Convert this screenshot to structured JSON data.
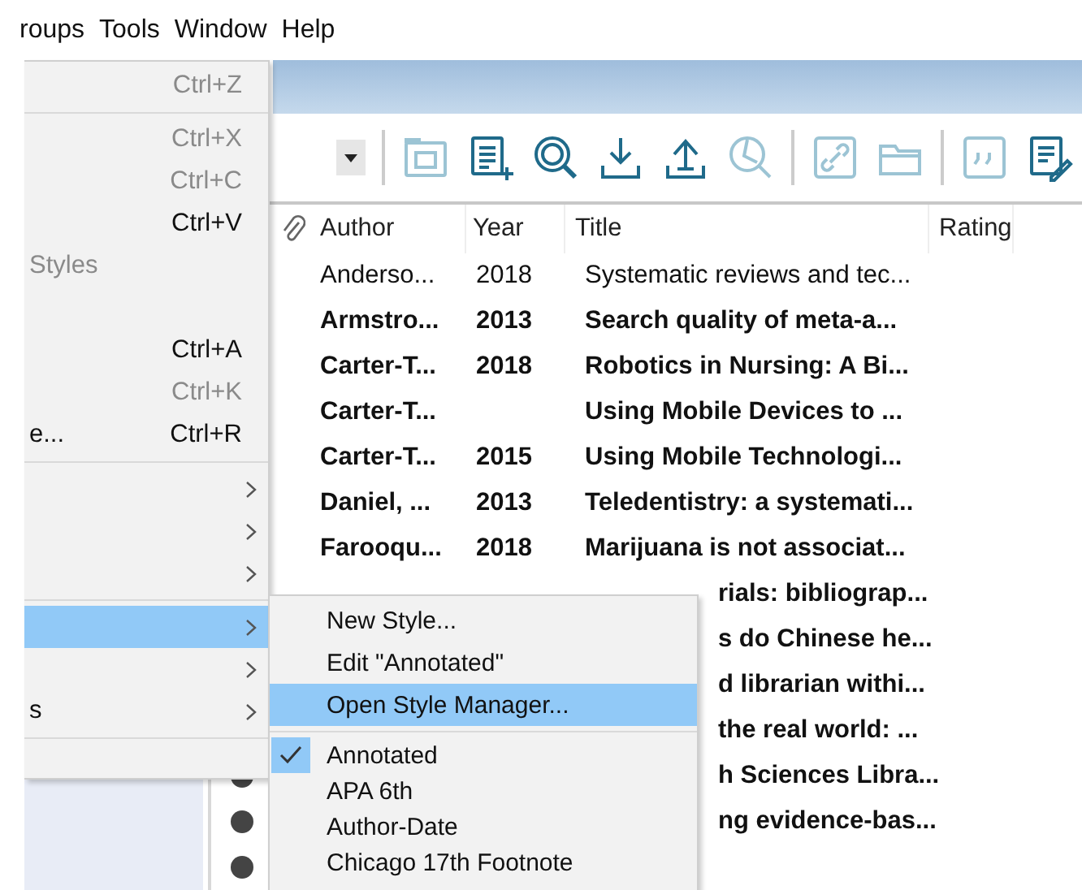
{
  "menubar": [
    {
      "label": "roups"
    },
    {
      "label": "Tools"
    },
    {
      "label": "Window"
    },
    {
      "label": "Help"
    }
  ],
  "toolbar": [
    {
      "kind": "dropdown",
      "disabled": false
    },
    {
      "kind": "separator"
    },
    {
      "kind": "group",
      "disabled": true
    },
    {
      "kind": "new-reference",
      "disabled": false
    },
    {
      "kind": "online-search",
      "disabled": false
    },
    {
      "kind": "import",
      "disabled": false
    },
    {
      "kind": "export",
      "disabled": false
    },
    {
      "kind": "pdf",
      "disabled": true
    },
    {
      "kind": "separator"
    },
    {
      "kind": "link",
      "disabled": true
    },
    {
      "kind": "folder",
      "disabled": true
    },
    {
      "kind": "separator"
    },
    {
      "kind": "quote",
      "disabled": true
    },
    {
      "kind": "edit",
      "disabled": false
    }
  ],
  "table": {
    "columns": [
      "Author",
      "Year",
      "Title",
      "Rating"
    ],
    "rows": [
      {
        "author": "Anderso...",
        "year": "2018",
        "title": "Systematic reviews and tec...",
        "bold": false
      },
      {
        "author": "Armstro...",
        "year": "2013",
        "title": "Search quality of meta-a...",
        "bold": true
      },
      {
        "author": "Carter-T...",
        "year": "2018",
        "title": "Robotics in Nursing: A Bi...",
        "bold": true
      },
      {
        "author": "Carter-T...",
        "title": "Using Mobile Devices to ...",
        "bold": true
      },
      {
        "author": "Carter-T...",
        "year": "2015",
        "title": "Using Mobile Technologi...",
        "bold": true
      },
      {
        "author": "Daniel, ...",
        "year": "2013",
        "title": "Teledentistry: a systemati...",
        "bold": true
      },
      {
        "author": "Farooqu...",
        "year": "2018",
        "title": "Marijuana is not associat...",
        "bold": true
      },
      {
        "title_tail": "rials: bibliograp...",
        "bold": true
      },
      {
        "title_tail": "s do Chinese he...",
        "bold": true
      },
      {
        "title_tail": "d librarian withi...",
        "bold": true
      },
      {
        "title_tail": "the real world: ...",
        "bold": true
      },
      {
        "title_tail": "h Sciences Libra...",
        "bold": true,
        "unread": true
      },
      {
        "title_tail": "ng evidence-bas...",
        "bold": true,
        "unread": true
      },
      {
        "unread": true
      }
    ]
  },
  "edit_menu": [
    {
      "kind": "item",
      "shortcut": "Ctrl+Z",
      "disabled": true,
      "selected": false
    },
    {
      "kind": "separator"
    },
    {
      "kind": "item",
      "shortcut": "Ctrl+X",
      "disabled": true,
      "selected": false
    },
    {
      "kind": "item",
      "shortcut": "Ctrl+C",
      "disabled": true,
      "selected": false
    },
    {
      "kind": "item",
      "shortcut": "Ctrl+V",
      "disabled": false,
      "selected": false
    },
    {
      "kind": "item",
      "label": "Styles",
      "disabled": true,
      "selected": false
    },
    {
      "kind": "spacer"
    },
    {
      "kind": "item",
      "shortcut": "Ctrl+A",
      "disabled": false,
      "selected": false
    },
    {
      "kind": "item",
      "shortcut": "Ctrl+K",
      "disabled": true,
      "selected": false
    },
    {
      "kind": "item",
      "label": "e...",
      "shortcut": "Ctrl+R",
      "disabled": false,
      "selected": false
    },
    {
      "kind": "separator"
    },
    {
      "kind": "submenu",
      "selected": false
    },
    {
      "kind": "submenu",
      "selected": false
    },
    {
      "kind": "submenu",
      "selected": false
    },
    {
      "kind": "separator"
    },
    {
      "kind": "submenu",
      "selected": true
    },
    {
      "kind": "submenu",
      "selected": false
    },
    {
      "kind": "submenu",
      "label": "s",
      "selected": false
    },
    {
      "kind": "separator"
    },
    {
      "kind": "spacer"
    }
  ],
  "style_submenu": [
    {
      "kind": "item",
      "label": "New Style...",
      "selected": false,
      "checked": false
    },
    {
      "kind": "item",
      "label": "Edit \"Annotated\"",
      "selected": false,
      "checked": false
    },
    {
      "kind": "item",
      "label": "Open Style Manager...",
      "selected": true,
      "checked": false
    },
    {
      "kind": "separator"
    },
    {
      "kind": "item",
      "label": "Annotated",
      "selected": false,
      "checked": true
    },
    {
      "kind": "item",
      "label": "APA 6th",
      "selected": false,
      "checked": false
    },
    {
      "kind": "item",
      "label": "Author-Date",
      "selected": false,
      "checked": false
    },
    {
      "kind": "item",
      "label": "Chicago 17th Footnote",
      "selected": false,
      "checked": false
    }
  ]
}
